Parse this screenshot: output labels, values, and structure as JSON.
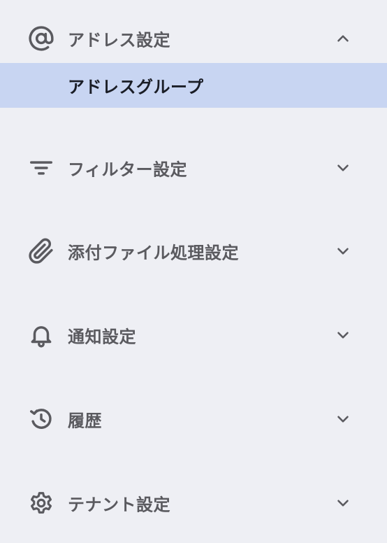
{
  "menu": {
    "address": {
      "label": "アドレス設定",
      "expanded": true,
      "icon": "at-sign-icon",
      "children": [
        {
          "label": "アドレスグループ",
          "selected": true
        }
      ]
    },
    "filter": {
      "label": "フィルター設定",
      "expanded": false,
      "icon": "filter-lines-icon"
    },
    "attachment": {
      "label": "添付ファイル処理設定",
      "expanded": false,
      "icon": "paperclip-icon"
    },
    "notification": {
      "label": "通知設定",
      "expanded": false,
      "icon": "bell-icon"
    },
    "history": {
      "label": "履歴",
      "expanded": false,
      "icon": "history-clock-icon"
    },
    "tenant": {
      "label": "テナント設定",
      "expanded": false,
      "icon": "gear-icon"
    }
  },
  "colors": {
    "background": "#eeeff4",
    "selected_background": "#c8d5f2",
    "label_text": "#5a5a5f",
    "selected_text": "#1a1d26",
    "icon": "#5a5a5f"
  }
}
